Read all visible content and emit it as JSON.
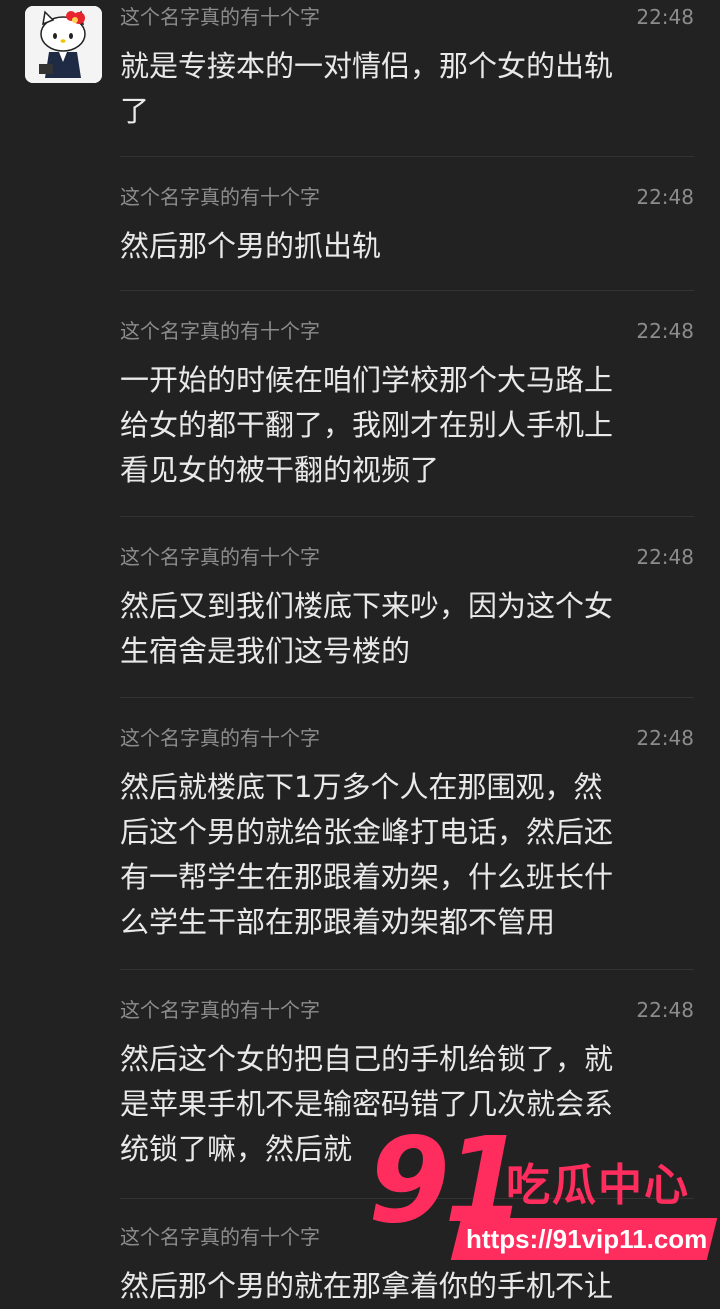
{
  "messages": [
    {
      "name": "这个名字真的有十个字",
      "time": "22:48",
      "text": "就是专接本的一对情侣，那个女的出轨\n了"
    },
    {
      "name": "这个名字真的有十个字",
      "time": "22:48",
      "text": "然后那个男的抓出轨"
    },
    {
      "name": "这个名字真的有十个字",
      "time": "22:48",
      "text": "一开始的时候在咱们学校那个大马路上\n给女的都干翻了，我刚才在别人手机上\n看见女的被干翻的视频了"
    },
    {
      "name": "这个名字真的有十个字",
      "time": "22:48",
      "text": "然后又到我们楼底下来吵，因为这个女\n生宿舍是我们这号楼的"
    },
    {
      "name": "这个名字真的有十个字",
      "time": "22:48",
      "text": "然后就楼底下1万多个人在那围观，然\n后这个男的就给张金峰打电话，然后还\n有一帮学生在那跟着劝架，什么班长什\n么学生干部在那跟着劝架都不管用"
    },
    {
      "name": "这个名字真的有十个字",
      "time": "22:48",
      "text": "然后这个女的把自己的手机给锁了，就\n是苹果手机不是输密码错了几次就会系\n统锁了嘛，然后就"
    },
    {
      "name": "这个名字真的有十个字",
      "time": "",
      "text": "然后那个男的就在那拿着你的手机不让"
    }
  ],
  "watermark": {
    "number": "91",
    "title": "吃瓜中心",
    "url": "https://91vip11.com"
  },
  "colors": {
    "background": "#222222",
    "meta": "#8c8c8c",
    "text": "#e9e9e9",
    "brand": "#ff2d5e"
  }
}
